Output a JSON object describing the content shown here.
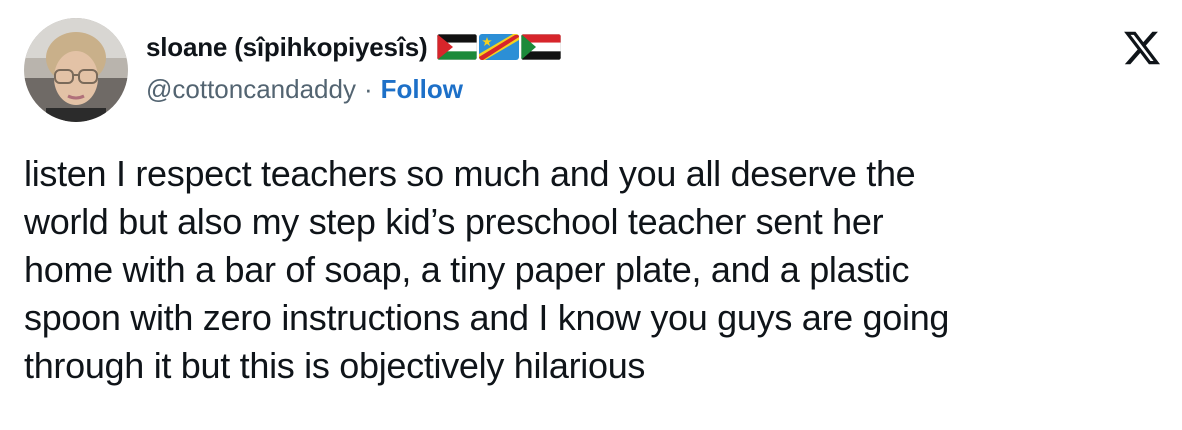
{
  "user": {
    "display_name": "sloane (sîpihkopiyesîs)",
    "handle": "@cottoncandaddy",
    "separator": "·",
    "follow_label": "Follow",
    "flags": [
      "palestine-flag-icon",
      "dr-congo-flag-icon",
      "sudan-flag-icon"
    ]
  },
  "tweet": {
    "text": "listen I respect teachers so much and you all deserve the\nworld but also my step kid’s preschool teacher sent her\nhome with a bar of soap, a tiny paper plate, and a plastic\nspoon with zero instructions and I know you guys are going\nthrough it but this is objectively hilarious"
  },
  "colors": {
    "follow": "#1d70c8",
    "handle": "#536471",
    "text": "#0f1419"
  },
  "icons": {
    "close": "x-logo-icon"
  }
}
